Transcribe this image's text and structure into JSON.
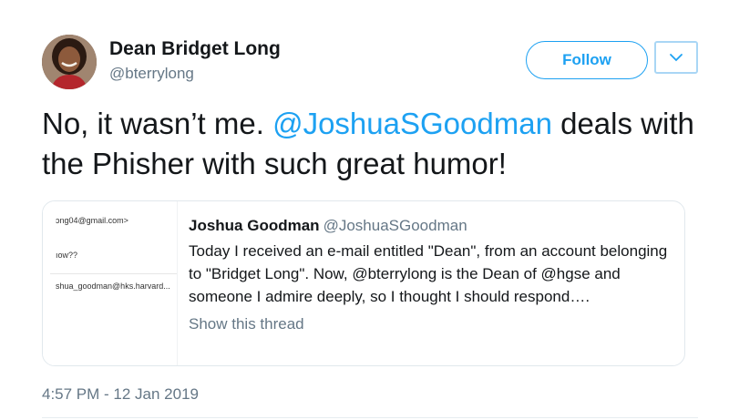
{
  "author": {
    "name": "Dean Bridget Long",
    "handle": "@bterrylong",
    "avatar_icon": "profile-photo"
  },
  "actions": {
    "follow_label": "Follow",
    "menu_icon": "chevron-down-icon"
  },
  "tweet": {
    "text_before": "No, it wasn’t me. ",
    "mention": "@JoshuaSGoodman",
    "text_after": " deals with the Phisher with such great humor!",
    "timestamp": "4:57 PM - 12 Jan 2019"
  },
  "quote": {
    "name": "Joshua Goodman",
    "handle": "@JoshuaSGoodman",
    "text": "Today I received an e-mail entitled \"Dean\", from an account belonging to \"Bridget Long\". Now, @bterrylong is the Dean of @hgse and someone I admire deeply, so I thought I should respond….",
    "show_thread": "Show this thread",
    "thumbnail_lines": [
      "ɔng04@gmail.com>",
      "ıow??",
      "shua_goodman@hks.harvard..."
    ]
  },
  "colors": {
    "accent": "#1da1f2",
    "secondary_text": "#657786",
    "primary_text": "#14171a"
  }
}
